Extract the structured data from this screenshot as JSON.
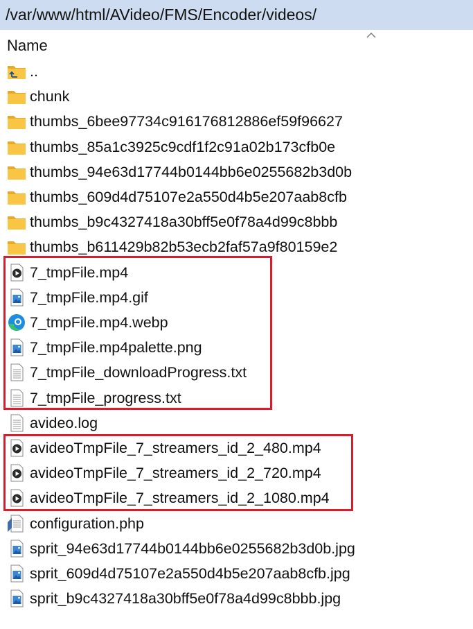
{
  "address_bar": {
    "path": "/var/www/html/AVideo/FMS/Encoder/videos/"
  },
  "column_header": {
    "name": "Name",
    "sort_icon": "chevron-up-icon"
  },
  "files": [
    {
      "label": "..",
      "icon": "folder-up-icon"
    },
    {
      "label": "chunk",
      "icon": "folder-icon"
    },
    {
      "label": "thumbs_6bee97734c916176812886ef59f96627",
      "icon": "folder-icon"
    },
    {
      "label": "thumbs_85a1c3925c9cdf1f2c91a02b173cfb0e",
      "icon": "folder-icon"
    },
    {
      "label": "thumbs_94e63d17744b0144bb6e0255682b3d0b",
      "icon": "folder-icon"
    },
    {
      "label": "thumbs_609d4d75107e2a550d4b5e207aab8cfb",
      "icon": "folder-icon"
    },
    {
      "label": "thumbs_b9c4327418a30bff5e0f78a4d99c8bbb",
      "icon": "folder-icon"
    },
    {
      "label": "thumbs_b611429b82b53ecb2faf57a9f80159e2",
      "icon": "folder-icon"
    },
    {
      "label": "7_tmpFile.mp4",
      "icon": "video-file-icon"
    },
    {
      "label": "7_tmpFile.mp4.gif",
      "icon": "image-file-icon"
    },
    {
      "label": "7_tmpFile.mp4.webp",
      "icon": "edge-browser-icon"
    },
    {
      "label": "7_tmpFile.mp4palette.png",
      "icon": "image-file-icon"
    },
    {
      "label": "7_tmpFile_downloadProgress.txt",
      "icon": "text-file-icon"
    },
    {
      "label": "7_tmpFile_progress.txt",
      "icon": "text-file-icon"
    },
    {
      "label": "avideo.log",
      "icon": "text-file-icon"
    },
    {
      "label": "avideoTmpFile_7_streamers_id_2_480.mp4",
      "icon": "video-file-icon"
    },
    {
      "label": "avideoTmpFile_7_streamers_id_2_720.mp4",
      "icon": "video-file-icon"
    },
    {
      "label": "avideoTmpFile_7_streamers_id_2_1080.mp4",
      "icon": "video-file-icon"
    },
    {
      "label": "configuration.php",
      "icon": "php-file-icon"
    },
    {
      "label": "sprit_94e63d17744b0144bb6e0255682b3d0b.jpg",
      "icon": "image-file-icon"
    },
    {
      "label": "sprit_609d4d75107e2a550d4b5e207aab8cfb.jpg",
      "icon": "image-file-icon"
    },
    {
      "label": "sprit_b9c4327418a30bff5e0f78a4d99c8bbb.jpg",
      "icon": "image-file-icon"
    }
  ],
  "colors": {
    "address_bar_bg": "#cddcf1",
    "highlight_border": "#d61f2c",
    "folder": "#f8c545"
  }
}
